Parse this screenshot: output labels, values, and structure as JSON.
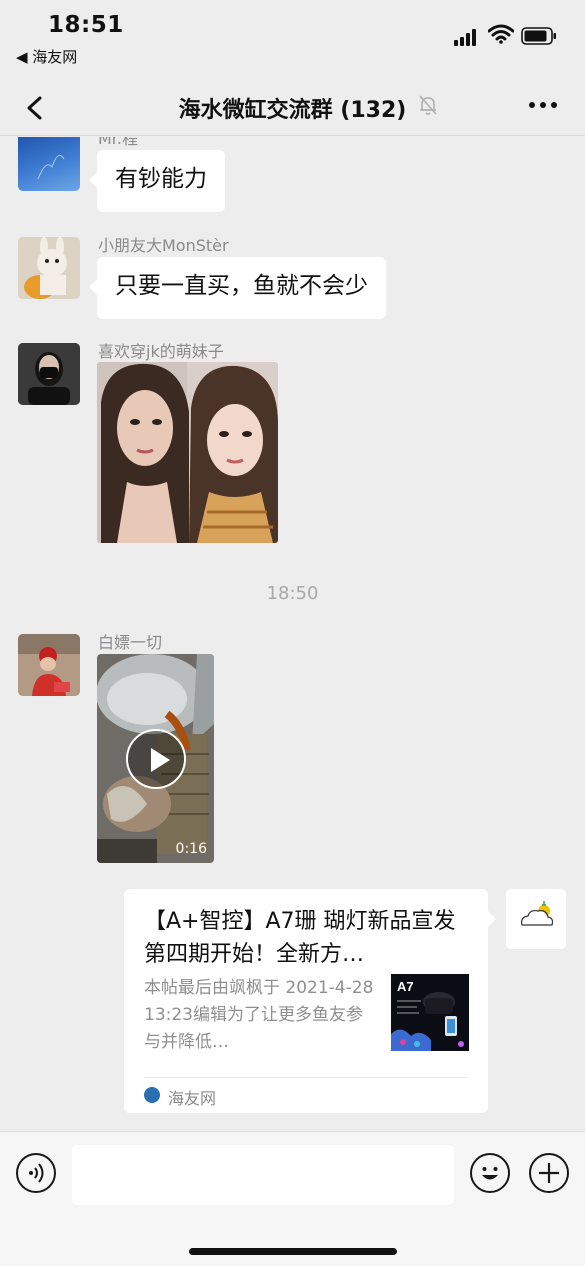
{
  "status_bar": {
    "time": "18:51",
    "back_app": "◀ 海友网"
  },
  "nav": {
    "title": "海水微缸交流群 (132)"
  },
  "messages": [
    {
      "sender": "Mr.程",
      "text": "有钞能力"
    },
    {
      "sender": "小朋友大MonStèr",
      "text": "只要一直买，鱼就不会少"
    },
    {
      "sender": "喜欢穿jk的萌妹子",
      "type": "photo"
    },
    {
      "sender": "白嫖一切",
      "type": "video",
      "duration": "0:16"
    }
  ],
  "timestamp": "18:50",
  "link_card": {
    "title": "【A+智控】A7珊 瑚灯新品宣发 第四期开始！全新方…",
    "description": "本帖最后由飒枫于 2021-4-2813:23编辑为了让更多鱼友参与并降低…",
    "thumbnail_label": "A7",
    "source": "海友网"
  },
  "input_bar": {
    "placeholder": ""
  },
  "colors": {
    "background": "#ededed",
    "bubble": "#ffffff",
    "muted_text": "#8a8a8a"
  }
}
